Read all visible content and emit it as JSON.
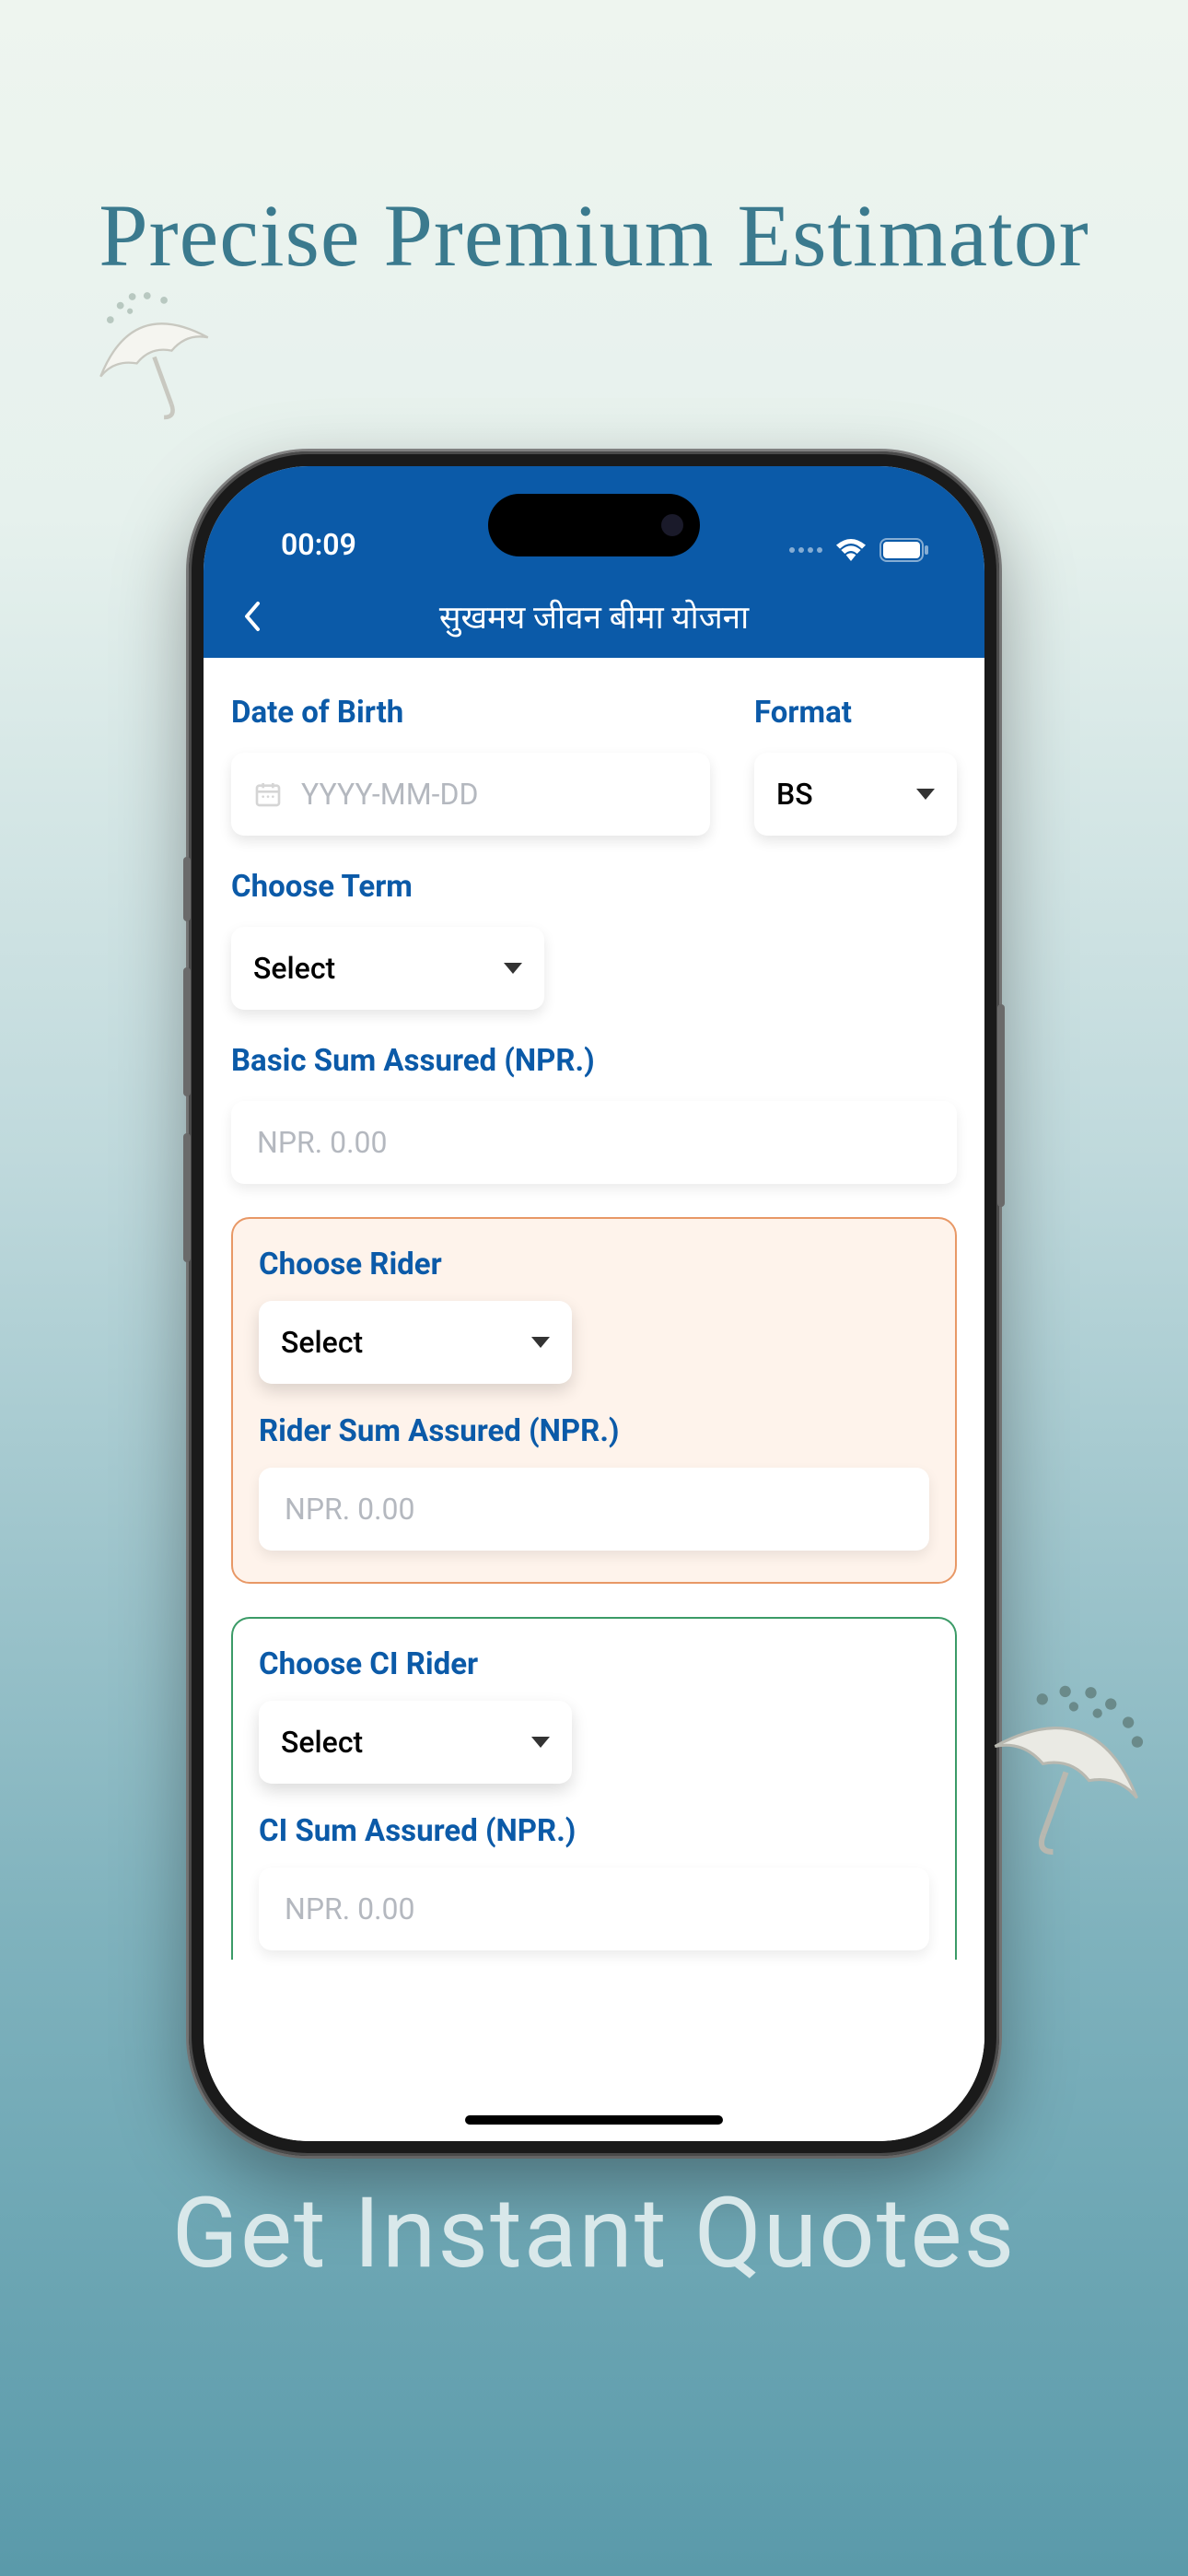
{
  "marketing": {
    "title": "Precise Premium Estimator",
    "footer": "Get Instant Quotes"
  },
  "status_bar": {
    "time": "00:09"
  },
  "nav": {
    "title": "सुखमय जीवन बीमा योजना"
  },
  "form": {
    "dob": {
      "label": "Date of Birth",
      "placeholder": "YYYY-MM-DD"
    },
    "format": {
      "label": "Format",
      "value": "BS"
    },
    "term": {
      "label": "Choose Term",
      "value": "Select"
    },
    "basic_sum": {
      "label": "Basic Sum Assured (NPR.)",
      "placeholder": "NPR. 0.00"
    },
    "rider": {
      "label": "Choose Rider",
      "value": "Select",
      "sum_label": "Rider Sum Assured (NPR.)",
      "sum_placeholder": "NPR. 0.00"
    },
    "ci_rider": {
      "label": "Choose CI Rider",
      "value": "Select",
      "sum_label": "CI Sum Assured (NPR.)",
      "sum_placeholder": "NPR. 0.00"
    }
  }
}
